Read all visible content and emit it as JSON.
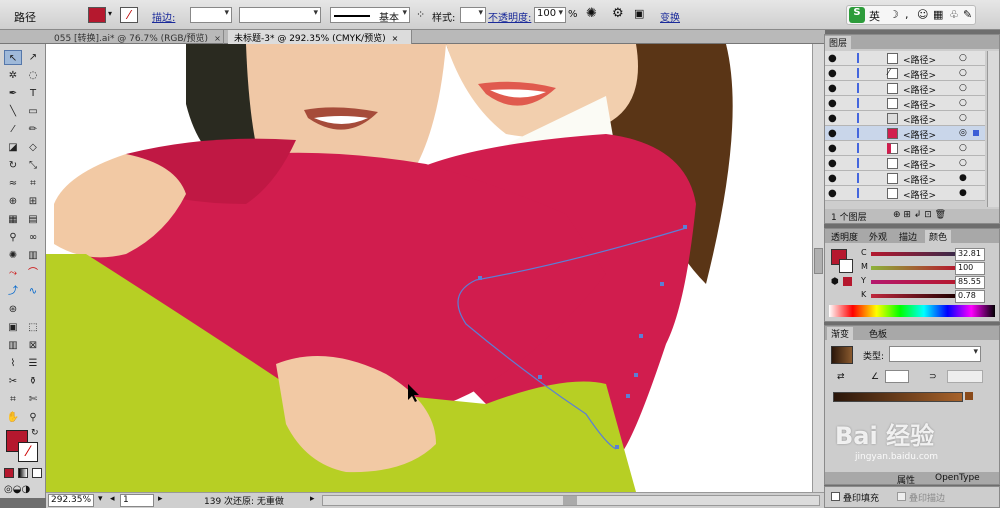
{
  "control_bar": {
    "object_type": "路径",
    "fill_color": "#b5182e",
    "stroke_label": "描边:",
    "line_style": "基本",
    "style_label": "样式:",
    "opacity_label": "不透明度:",
    "opacity_value": "100",
    "percent": "%",
    "transform_label": "变换"
  },
  "tabs": [
    {
      "label": "055 [转换].ai* @ 76.7% (RGB/预览)",
      "close": "×"
    },
    {
      "label": "未标题-3* @ 292.35% (CMYK/预览)",
      "close": "×"
    }
  ],
  "ime": {
    "logo": "S",
    "lang": "英",
    "icons": [
      "moon-icon",
      "comma-icon",
      "smile-icon",
      "keyboard-icon",
      "shirt-icon",
      "wrench-icon"
    ]
  },
  "colors": {
    "fill": "#b5182e",
    "canvas_red": "#d11d4e",
    "canvas_green": "#b7cf24",
    "path_blue": "#5b7fd6"
  },
  "layers_panel": {
    "title": "图层",
    "items": [
      "<路径>",
      "<路径>",
      "<路径>",
      "<路径>",
      "<路径>",
      "<路径>",
      "<路径>",
      "<路径>",
      "<路径>",
      "<路径>"
    ],
    "count": "1 个图层"
  },
  "color_panel": {
    "tabs": [
      "透明度",
      "外观",
      "描边",
      "颜色"
    ],
    "channels": [
      {
        "name": "C",
        "value": "32.81"
      },
      {
        "name": "M",
        "value": "100"
      },
      {
        "name": "Y",
        "value": "85.55"
      },
      {
        "name": "K",
        "value": "0.78"
      }
    ]
  },
  "gradient_panel": {
    "tabs": [
      "渐变",
      "色板"
    ],
    "type_label": "类型:",
    "brand": "Bai 经验",
    "url": "jingyan.baidu.com"
  },
  "attributes": {
    "overprint_fill": "叠印填充",
    "overprint_stroke": "叠印描边",
    "tabs": [
      "属性",
      "OpenType"
    ]
  },
  "status": {
    "zoom": "292.35%",
    "page": "1",
    "message": "139 次还原: 无重做"
  }
}
